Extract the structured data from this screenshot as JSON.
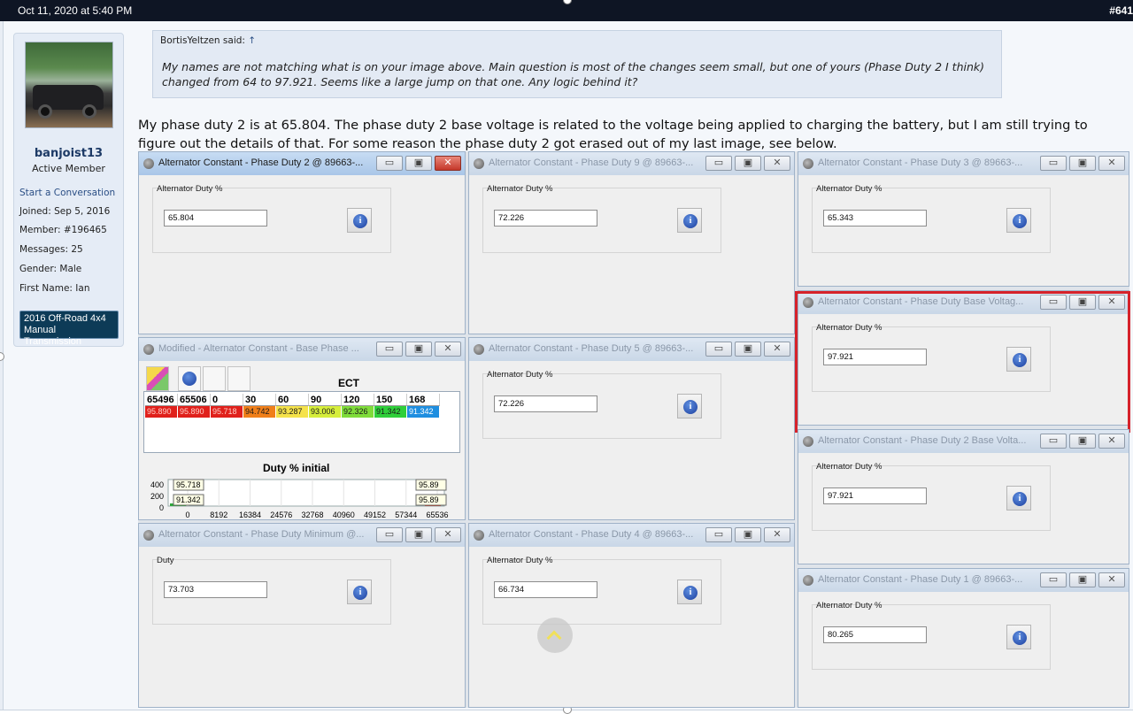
{
  "topbar": {
    "date": "Oct 11, 2020 at 5:40 PM",
    "post_number": "#641"
  },
  "user": {
    "name": "banjoist13",
    "title": "Active Member",
    "start_conversation": "Start a Conversation",
    "joined": "Joined:  Sep 5, 2016",
    "member": "Member:  #196465",
    "messages": "Messages:  25",
    "gender": "Gender:  Male",
    "first_name": "First Name:  Ian",
    "vehicle_line1": "2016 Off-Road 4x4",
    "vehicle_line2": "Manual Transmission"
  },
  "quote": {
    "author": "BortisYeltzen said:",
    "arrow": "↑",
    "text": "My names are not matching what is on your image above. Main question is most of the changes seem small, but one of yours (Phase Duty 2 I think) changed from 64 to 97.921. Seems like a large jump on that one. Any logic behind it?"
  },
  "post_text": "My phase duty 2 is at 65.804. The phase duty 2 base voltage is related to the voltage being applied to charging the battery, but I am still trying to figure out the details of that. For some reason the phase duty 2 got erased out of my last image, see below.",
  "window_buttons": {
    "minimize": "▭",
    "maximize": "▣",
    "close": "✕"
  },
  "info_glyph": "i",
  "windows": [
    {
      "title": "Alternator Constant - Phase Duty 2 @ 89663-...",
      "label": "Alternator Duty %",
      "value": "65.804"
    },
    {
      "title": "Alternator Constant - Phase Duty 9 @ 89663-...",
      "label": "Alternator Duty %",
      "value": "72.226"
    },
    {
      "title": "Alternator Constant - Phase Duty 3 @ 89663-...",
      "label": "Alternator Duty %",
      "value": "65.343"
    },
    {
      "title": "Alternator Constant - Phase Duty Base Voltag...",
      "label": "Alternator Duty %",
      "value": "97.921"
    },
    {
      "title": "Alternator Constant - Phase Duty 5 @ 89663-...",
      "label": "Alternator Duty %",
      "value": "72.226"
    },
    {
      "title": "Alternator Constant - Phase Duty 2 Base Volta...",
      "label": "Alternator Duty %",
      "value": "97.921"
    },
    {
      "title": "Alternator Constant - Phase Duty Minimum @...",
      "label": "Duty",
      "value": "73.703"
    },
    {
      "title": "Alternator Constant - Phase Duty 4 @ 89663-...",
      "label": "Alternator Duty %",
      "value": "66.734"
    },
    {
      "title": "Alternator Constant - Phase Duty 1 @ 89663-...",
      "label": "Alternator Duty %",
      "value": "80.265"
    }
  ],
  "table_window": {
    "title": "Modified - Alternator Constant - Base Phase ...",
    "axis_label": "ECT",
    "headers": [
      "65496",
      "65506",
      "0",
      "30",
      "60",
      "90",
      "120",
      "150",
      "168"
    ],
    "values": [
      "95.890",
      "95.890",
      "95.718",
      "94.742",
      "93.287",
      "93.006",
      "92.326",
      "91.342",
      "91.342"
    ],
    "cell_colors": [
      "#e0201b",
      "#e0201b",
      "#e0201b",
      "#f07f1a",
      "#f5e24a",
      "#d6ee3a",
      "#7fdc3a",
      "#2fcf3a",
      "#1e8ee0"
    ],
    "chart_title": "Duty % initial",
    "y_ticks": [
      "400",
      "200",
      "0"
    ],
    "x_ticks": [
      "0",
      "8192",
      "16384",
      "24576",
      "32768",
      "40960",
      "49152",
      "57344",
      "65536"
    ],
    "callouts": [
      "95.718",
      "91.342",
      "95.89",
      "95.89"
    ]
  }
}
